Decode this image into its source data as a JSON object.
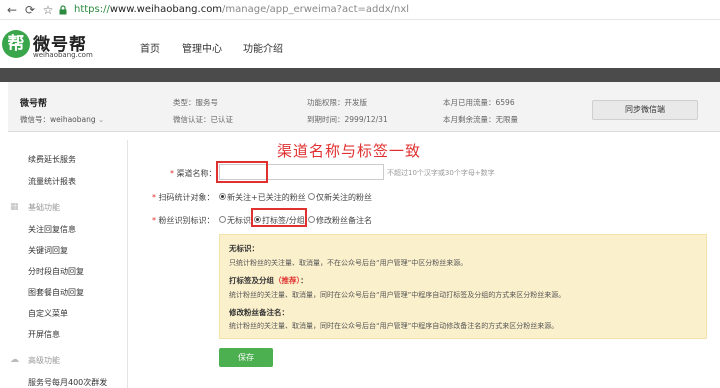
{
  "browser": {
    "url_proto": "https://",
    "url_host": "www.weihaobang.com",
    "url_path": "/manage/app_erweima?act=addx/nxl"
  },
  "site": {
    "logo_char": "帮",
    "logo_name": "微号帮",
    "logo_domain": "weihaobang.com",
    "nav": [
      "首页",
      "管理中心",
      "功能介绍"
    ]
  },
  "account": {
    "name": "微号帮",
    "wechat_id": "微信号：weihaobang",
    "type": "类型：服务号",
    "verify": "微信认证：已认证",
    "permission": "功能权限：开发版",
    "expire": "到期时间：2999/12/31",
    "month_used": "本月已用流量：6596",
    "month_left": "本月剩余流量：无限量",
    "sync_button": "同步微信端"
  },
  "sidebar": {
    "items_top": [
      "续费延长服务",
      "流量统计报表"
    ],
    "group_basic": "基础功能",
    "items_basic": [
      "关注回复信息",
      "关键词回复",
      "分时段自动回复",
      "图套餐自动回复",
      "自定义菜单",
      "开屏信息"
    ],
    "group_advanced": "高级功能",
    "items_advanced": [
      "服务号每月400次群发"
    ]
  },
  "form": {
    "channel_label": "渠道名称：",
    "channel_value": "",
    "channel_hint": "不超过10个汉字或30个字母+数字",
    "scan_label": "扫码统计对象：",
    "scan_options": [
      "新关注+已关注的粉丝",
      "仅新关注的粉丝"
    ],
    "scan_selected": 0,
    "fan_label": "粉丝识别标识：",
    "fan_options": [
      "无标识",
      "打标签/分组",
      "修改粉丝备注名"
    ],
    "fan_selected": 1,
    "annotation": "渠道名称与标签一致",
    "save_button": "保存"
  },
  "notice": {
    "h1": "无标识：",
    "p1": "只统计粉丝的关注量、取消量，不在公众号后台“用户管理”中区分粉丝来源。",
    "h2": "打标签及分组",
    "h2_rec": "（推荐）",
    "h2_colon": "：",
    "p2": "统计粉丝的关注量、取消量，同时在公众号后台“用户管理”中程序自动打标签及分组的方式来区分粉丝来源。",
    "h3": "修改粉丝备注名：",
    "p3": "统计粉丝的关注量、取消量，同时在公众号后台“用户管理”中程序自动修改备注名的方式来区分粉丝来源。"
  },
  "colors": {
    "brand_green": "#3aa64c",
    "annotation_red": "#e03131",
    "notice_bg": "#fbf0cc",
    "save_green": "#4caf50"
  }
}
